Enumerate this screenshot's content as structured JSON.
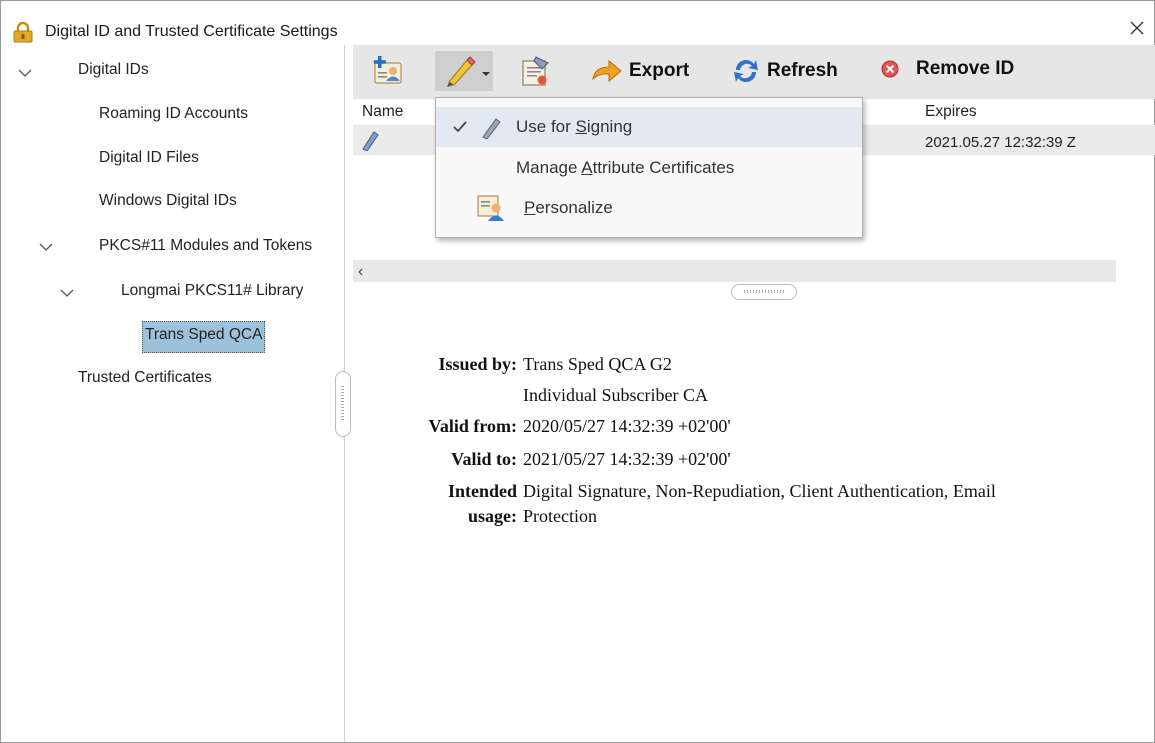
{
  "window": {
    "title": "Digital ID and Trusted Certificate Settings"
  },
  "tree": {
    "digital_ids": "Digital IDs",
    "roaming": "Roaming ID Accounts",
    "files": "Digital ID Files",
    "windows": "Windows Digital IDs",
    "pkcs": "PKCS#11 Modules and Tokens",
    "longmai": "Longmai PKCS11# Library",
    "trans_sped": "Trans Sped QCA",
    "trusted": "Trusted Certificates"
  },
  "toolbar": {
    "export_label": "Export",
    "refresh_label": "Refresh",
    "remove_label": "Remove ID"
  },
  "list": {
    "col_name": "Name",
    "col_expires": "Expires",
    "row_expires": "2021.05.27 12:32:39 Z"
  },
  "menu": {
    "use_signing_pre": "Use for ",
    "use_signing_u": "S",
    "use_signing_post": "igning",
    "manage_pre": "Manage ",
    "manage_u": "A",
    "manage_post": "ttribute Certificates",
    "personalize_u": "P",
    "personalize_post": "ersonalize"
  },
  "details": {
    "issued_by_label": "Issued by:",
    "issued_by_line1": "Trans Sped QCA G2",
    "issued_by_line2": "Individual Subscriber CA",
    "valid_from_label": "Valid from:",
    "valid_from": "2020/05/27 14:32:39 +02'00'",
    "valid_to_label": "Valid to:",
    "valid_to": "2021/05/27 14:32:39 +02'00'",
    "usage_label_1": "Intended",
    "usage_label_2": "usage:",
    "usage_line1": "Digital Signature, Non-Repudiation, Client Authentication, Email",
    "usage_line2": "Protection"
  },
  "icons": {
    "title": "lock-icon",
    "close": "close-icon",
    "add_id": "add-digital-id-icon",
    "pen": "pen-icon",
    "cert": "certificate-icon",
    "export": "export-arrow-icon",
    "refresh": "refresh-icon",
    "remove": "remove-icon"
  },
  "colors": {
    "selection": "#9ec1db",
    "toolbar": "#e6e6e6",
    "menu_highlight": "#e2e9f3"
  }
}
